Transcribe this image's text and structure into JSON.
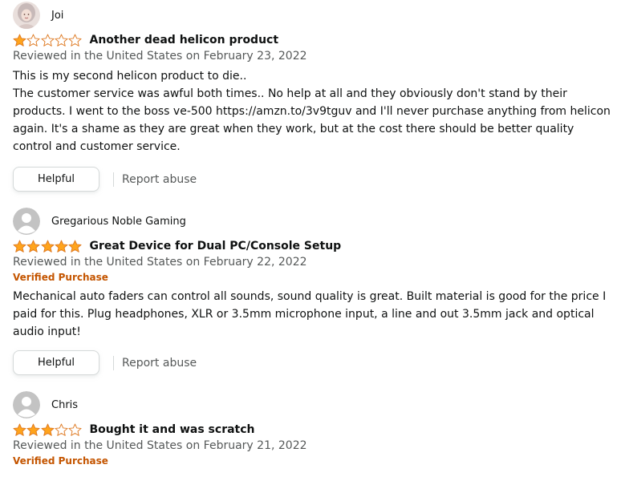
{
  "colors": {
    "star_fill": "#ffa41c",
    "star_outline": "#de7921",
    "verified": "#c45500"
  },
  "reviews": [
    {
      "profile": {
        "name": "Joi",
        "avatar": "photo-avatar"
      },
      "rating": 1,
      "title": "Another dead helicon product",
      "date": "Reviewed in the United States on February 23, 2022",
      "verified": "",
      "body": "This is my second helicon product to die..\nThe customer service was awful both times.. No help at all and they obviously don't stand by their products. I went to the boss ve-500 https://amzn.to/3v9tguv and I'll never purchase anything from helicon again. It's a shame as they are great when they work, but at the cost there should be better quality control and customer service.",
      "helpful_label": "Helpful",
      "report_label": "Report abuse"
    },
    {
      "profile": {
        "name": "Gregarious Noble Gaming",
        "avatar": "default-avatar"
      },
      "rating": 5,
      "title": "Great Device for Dual PC/Console Setup",
      "date": "Reviewed in the United States on February 22, 2022",
      "verified": "Verified Purchase",
      "body": "Mechanical auto faders can control all sounds, sound quality is great. Built material is good for the price I paid for this. Plug headphones, XLR or 3.5mm microphone input, a line and out 3.5mm jack and optical audio input!",
      "helpful_label": "Helpful",
      "report_label": "Report abuse"
    },
    {
      "profile": {
        "name": "Chris",
        "avatar": "default-avatar"
      },
      "rating": 3,
      "title": "Bought it and was scratch",
      "date": "Reviewed in the United States on February 21, 2022",
      "verified": "Verified Purchase",
      "body": "",
      "helpful_label": "",
      "report_label": ""
    }
  ]
}
